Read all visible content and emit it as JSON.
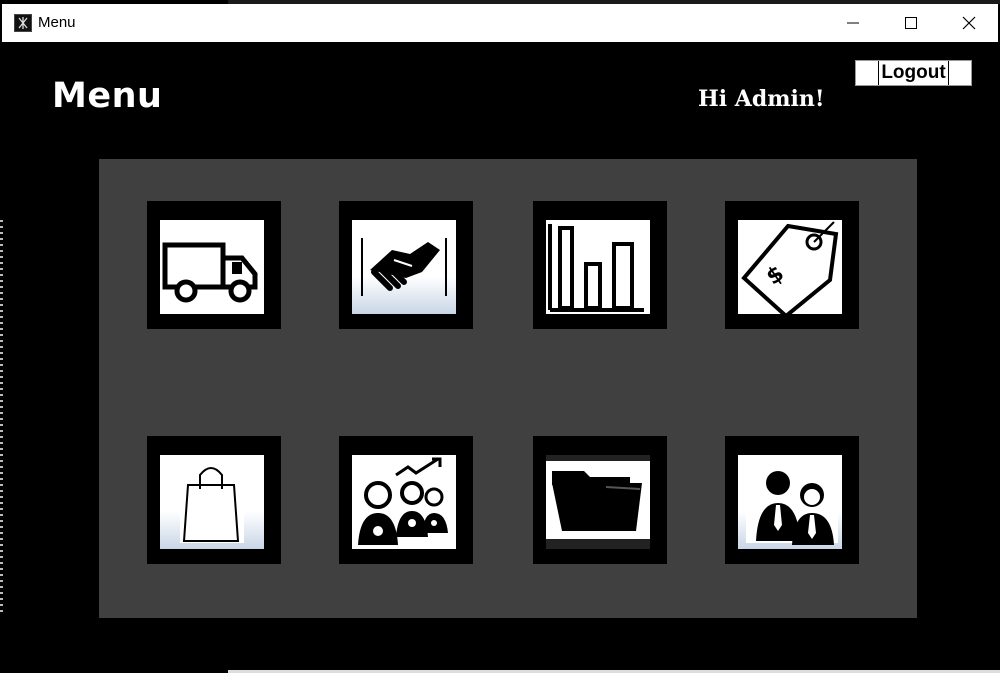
{
  "window": {
    "title": "Menu"
  },
  "header": {
    "title": "Menu",
    "greeting": "Hi Admin!",
    "logout_label": "Logout"
  },
  "menu": {
    "tiles": [
      {
        "icon": "delivery-truck-icon"
      },
      {
        "icon": "handshake-icon"
      },
      {
        "icon": "bar-chart-icon"
      },
      {
        "icon": "price-tag-icon"
      },
      {
        "icon": "shopping-bag-icon"
      },
      {
        "icon": "customers-growth-icon"
      },
      {
        "icon": "folder-icon"
      },
      {
        "icon": "employees-icon"
      }
    ]
  }
}
